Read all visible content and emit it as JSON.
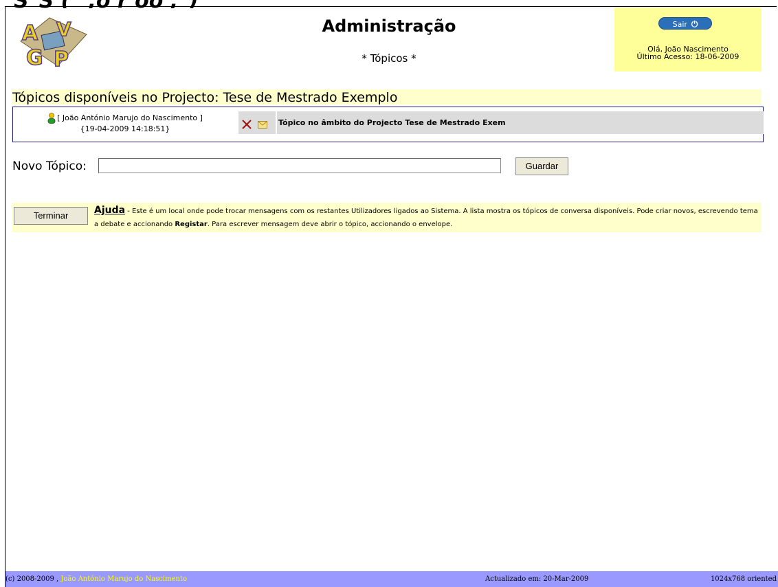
{
  "window": {
    "title_fragment": "S_S (\" ,o r oo ,\")"
  },
  "header": {
    "title": "Administração",
    "subtitle": "* Tópicos *",
    "logout_label": "Sair",
    "logout_icon": "power-icon",
    "greeting": "Olá, João Nascimento",
    "last_access": "Último Acesso: 18-06-2009",
    "userbox_color": "#ffff9a"
  },
  "project": {
    "heading": "Tópicos disponíveis no Projecto: Tese de Mestrado Exemplo"
  },
  "topics": [
    {
      "author": "[ João António Marujo do Nascimento ]",
      "datetime": "{19-04-2009 14:18:51}",
      "title": "Tópico no âmbito do Projecto Tese de Mestrado Exem"
    }
  ],
  "new_topic": {
    "label": "Novo Tópico:",
    "value": "",
    "save_label": "Guardar"
  },
  "help": {
    "finish_label": "Terminar",
    "title": "Ajuda",
    "text_before": " - Este é um local onde pode trocar mensagens com os restantes Utilizadores ligados ao Sistema. A lista mostra os tópicos de conversa disponíveis. Pode criar novos, escrevendo tema a debate e accionando ",
    "bold_word": "Registar",
    "text_after": ". Para escrever mensagem deve abrir o tópico, accionando o envelope."
  },
  "footer": {
    "copyright": "(c) 2008-2009 , ",
    "author": "João António Marujo do Nascimento",
    "updated": "Actualizado em: 20-Mar-2009",
    "resolution": "1024x768 oriented",
    "bg_color": "#9999ff"
  }
}
